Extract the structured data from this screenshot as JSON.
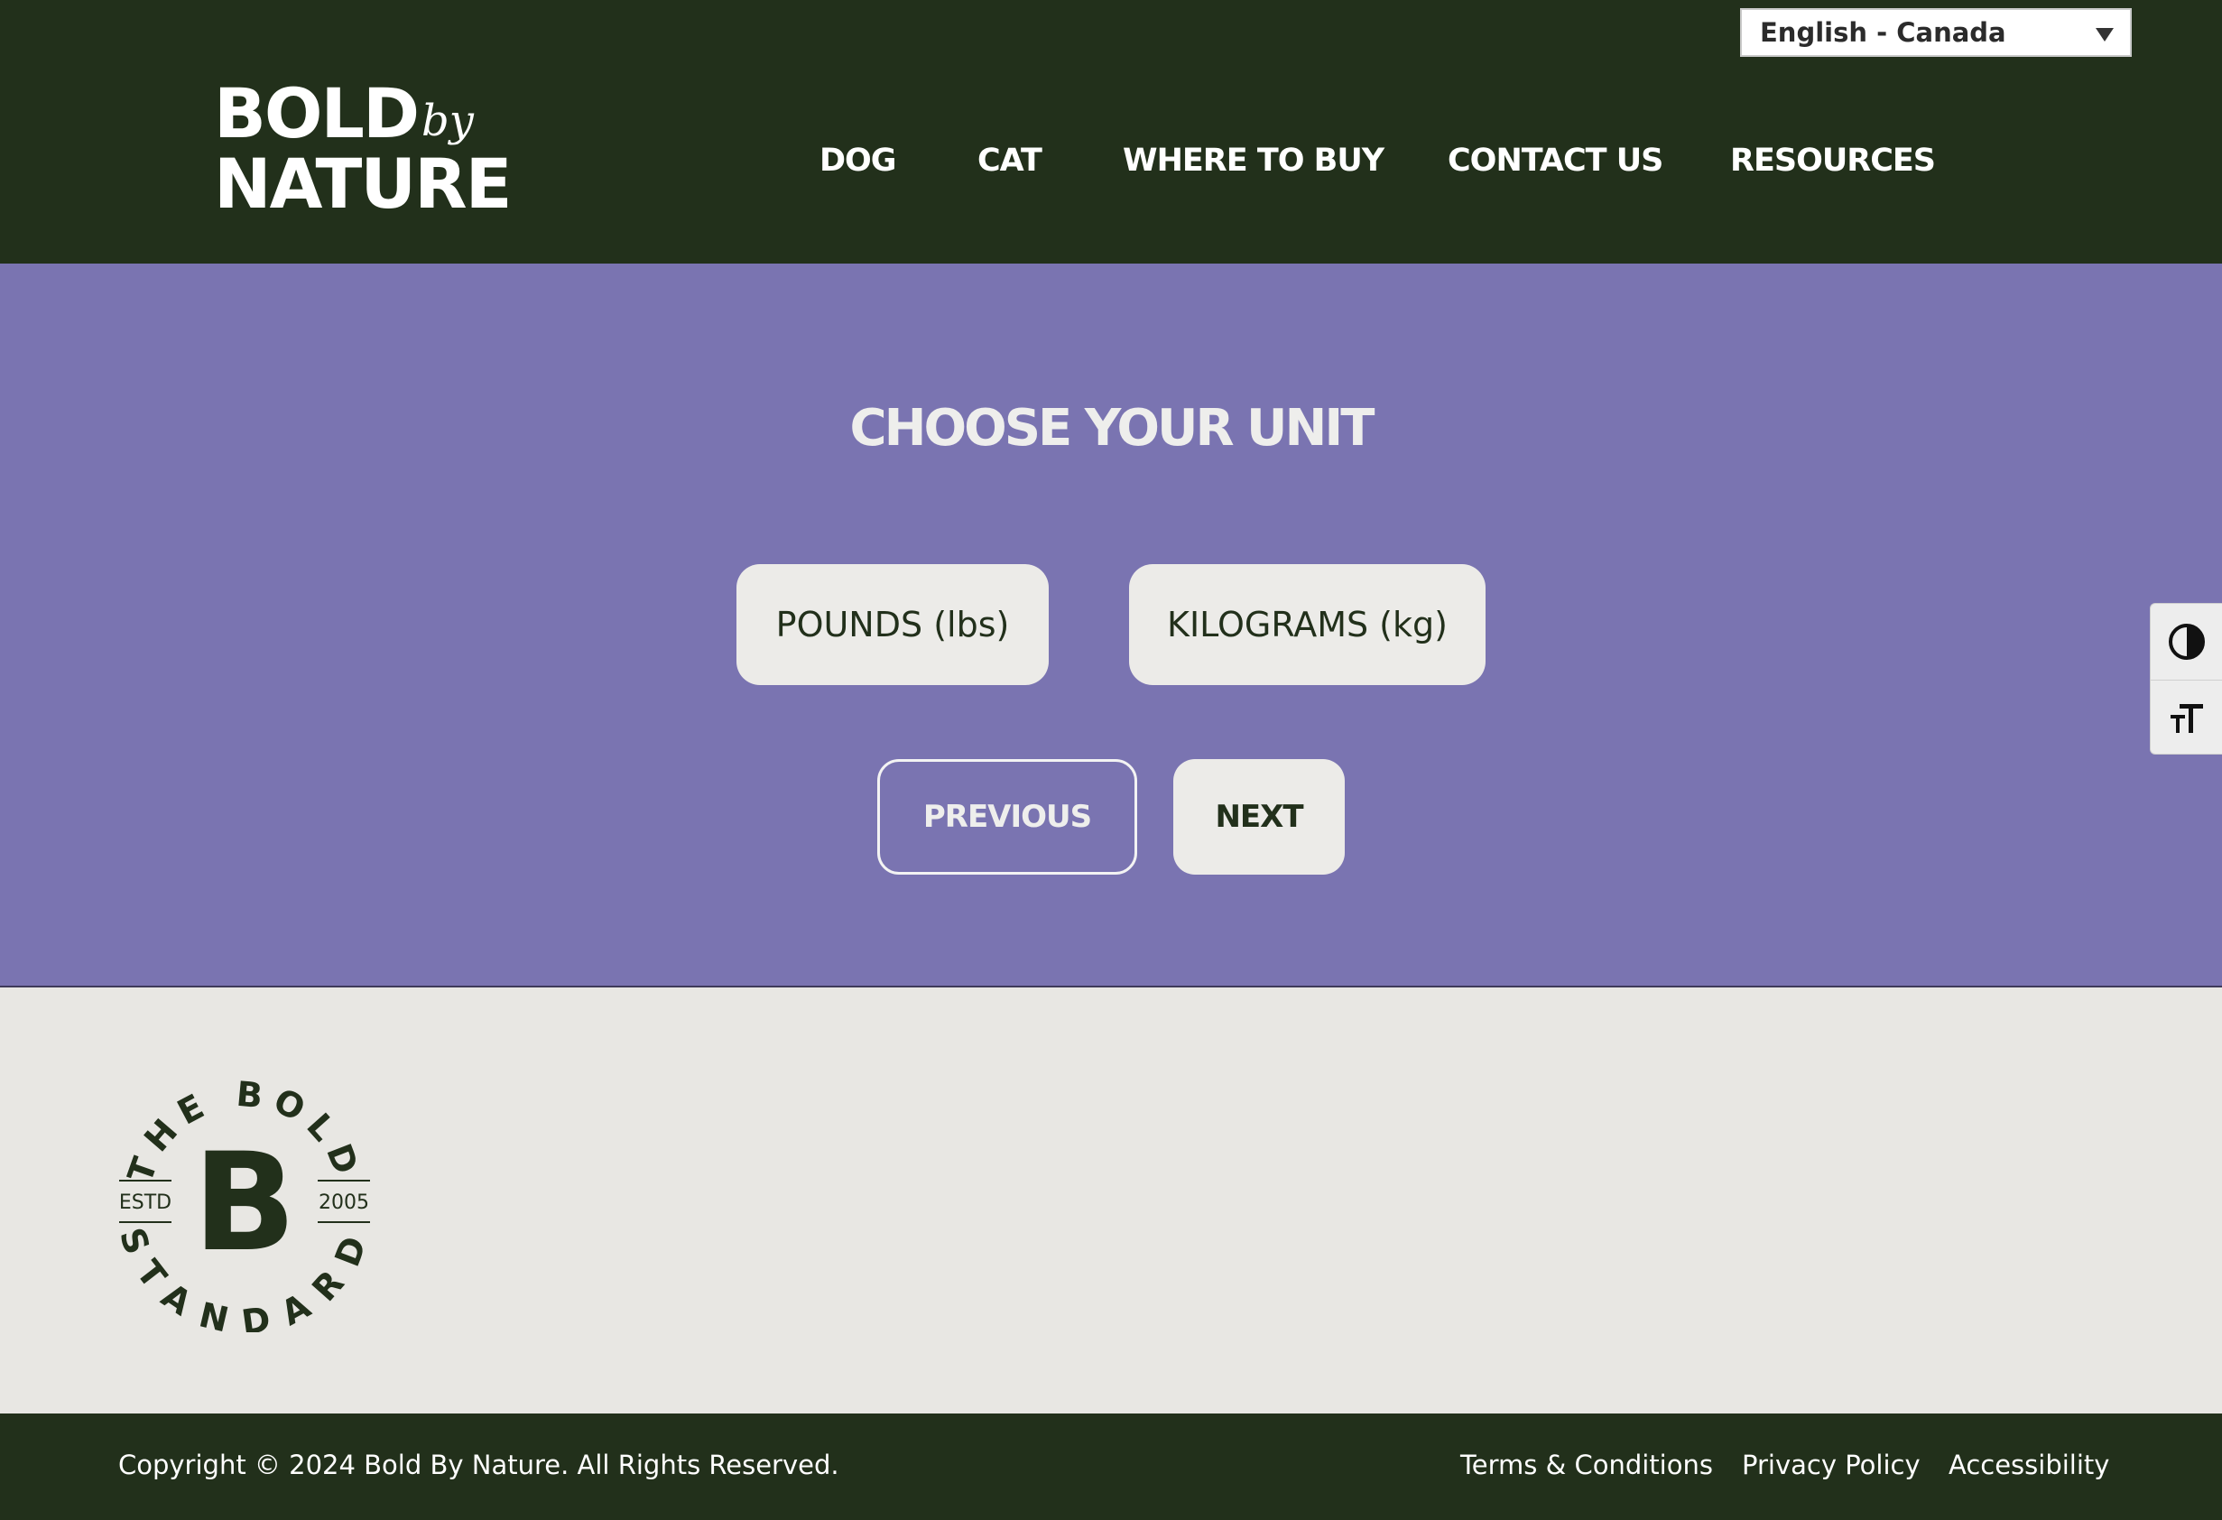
{
  "header": {
    "language": {
      "selected": "English - Canada"
    },
    "logo": {
      "line1": "BOLD",
      "by": "by",
      "line2": "NATURE"
    },
    "nav": [
      "DOG",
      "CAT",
      "WHERE TO BUY",
      "CONTACT US",
      "RESOURCES"
    ]
  },
  "main": {
    "title": "CHOOSE YOUR UNIT",
    "units": [
      "POUNDS (lbs)",
      "KILOGRAMS (kg)"
    ],
    "previous_label": "PREVIOUS",
    "next_label": "NEXT"
  },
  "seal": {
    "top_text": "THE BOLD",
    "bottom_text": "STANDARD",
    "left_text": "ESTD",
    "right_text": "2005",
    "center": "B"
  },
  "footer": {
    "copyright": "Copyright © 2024 Bold By Nature. All Rights Reserved.",
    "links": [
      "Terms & Conditions",
      "Privacy Policy",
      "Accessibility"
    ]
  },
  "colors": {
    "dark_green": "#22301b",
    "lavender": "#7a74b1",
    "off_white": "#e8e7e3"
  },
  "icons": {
    "contrast": "contrast-icon",
    "font_size": "font-size-icon",
    "dropdown": "chevron-down-icon"
  }
}
